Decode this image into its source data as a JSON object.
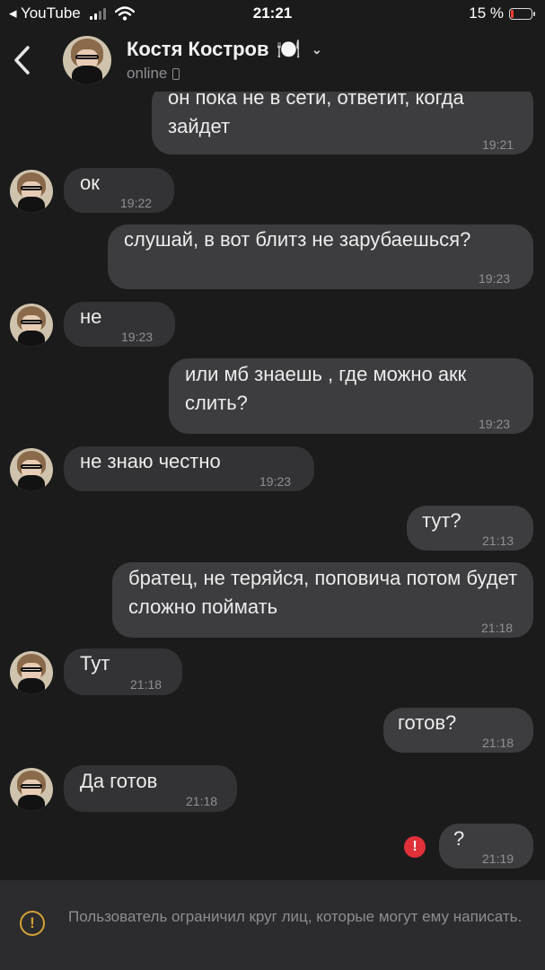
{
  "status_bar": {
    "back_app": "◂ YouTube",
    "time": "21:21",
    "battery_percent": "15 %",
    "battery_level": 0.15
  },
  "header": {
    "back_icon": "chevron-left-icon",
    "name": "Костя Костров",
    "name_emoji": "🍽️",
    "status": "online"
  },
  "messages": [
    {
      "dir": "out",
      "text": "он пока не в сети, ответит, когда зайдет",
      "time": "19:21"
    },
    {
      "dir": "in",
      "text": "ок",
      "time": "19:22"
    },
    {
      "dir": "out",
      "text": "слушай, в вот блитз не зарубаешься?",
      "time": "19:23"
    },
    {
      "dir": "in",
      "text": "не",
      "time": "19:23"
    },
    {
      "dir": "out",
      "text": "или мб знаешь , где можно акк слить?",
      "time": "19:23"
    },
    {
      "dir": "in",
      "text": "не знаю честно",
      "time": "19:23"
    },
    {
      "dir": "out",
      "text": "тут?",
      "time": "21:13"
    },
    {
      "dir": "out",
      "text": "братец, не теряйся, поповича потом будет сложно поймать",
      "time": "21:18"
    },
    {
      "dir": "in",
      "text": "Тут",
      "time": "21:18"
    },
    {
      "dir": "out",
      "text": "готов?",
      "time": "21:18"
    },
    {
      "dir": "in",
      "text": "Да готов",
      "time": "21:18"
    },
    {
      "dir": "out",
      "text": "?",
      "time": "21:19",
      "failed": true
    }
  ],
  "footer": {
    "warning_icon": "exclamation-circle-icon",
    "text": "Пользователь ограничил круг лиц, которые могут ему написать."
  },
  "colors": {
    "background": "#1b1b1c",
    "bubble": "#333335",
    "warning": "#d6a235",
    "error": "#e0303a"
  }
}
